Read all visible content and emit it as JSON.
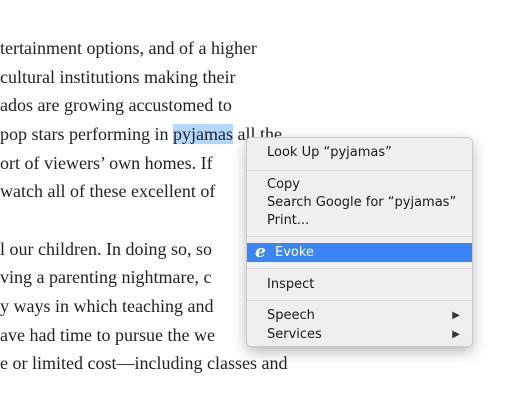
{
  "article": {
    "lines": [
      "tertainment options, and of a higher",
      " cultural institutions making their",
      "ados are growing accustomed to",
      " pop stars performing in ",
      "ort of viewers’ own homes. If",
      " watch all of these excellent of",
      "",
      "l our children. In doing so, so",
      "ving a parenting nightmare, c",
      "y ways in which teaching and",
      "ave had time to pursue the we",
      "e or limited cost—including classes and"
    ],
    "selected_word": "pyjamas",
    "after_selection": " all the"
  },
  "context_menu": {
    "look_up": "Look Up “pyjamas”",
    "copy": "Copy",
    "search_google": "Search Google for “pyjamas”",
    "print": "Print...",
    "evoke": "Evoke",
    "evoke_icon": "e",
    "inspect": "Inspect",
    "speech": "Speech",
    "services": "Services",
    "submenu_arrow": "▶",
    "highlight_color": "#3b86f5"
  }
}
